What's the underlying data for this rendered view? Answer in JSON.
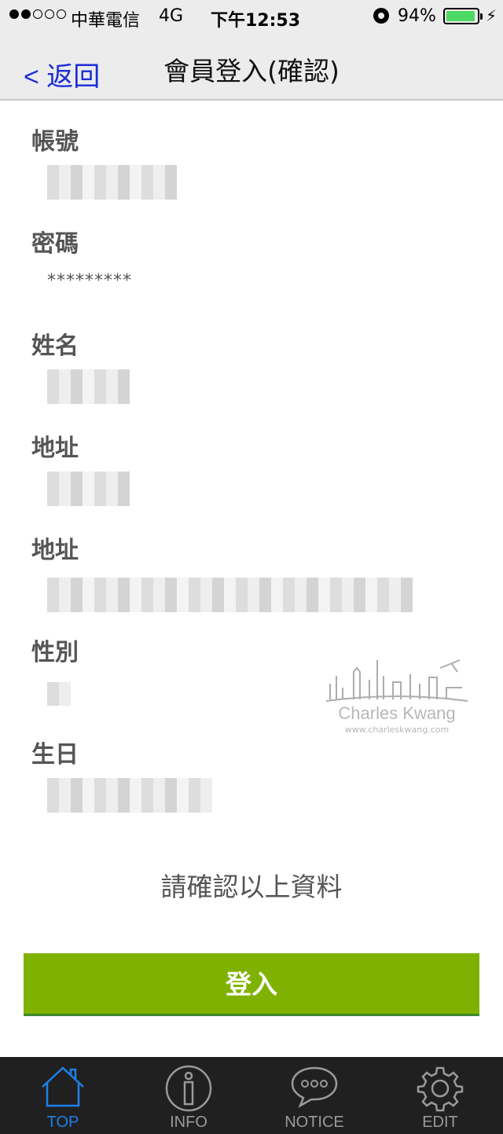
{
  "status_bar": {
    "carrier": "中華電信",
    "network": "4G",
    "time": "下午12:53",
    "battery_percent": "94%",
    "battery_level": 0.94,
    "signal_bars_filled": 2,
    "signal_bars_total": 5
  },
  "nav": {
    "back_label": "< 返回",
    "title": "會員登入(確認)"
  },
  "form": {
    "account_label": "帳號",
    "password_label": "密碼",
    "password_value": "*********",
    "name_label": "姓名",
    "address1_label": "地址",
    "address2_label": "地址",
    "gender_label": "性別",
    "birthday_label": "生日"
  },
  "confirm_text": "請確認以上資料",
  "login_button": "登入",
  "watermark": {
    "name": "Charles Kwang",
    "url": "www.charleskwang.com"
  },
  "tabs": [
    {
      "label": "TOP",
      "icon": "home-icon",
      "active": true
    },
    {
      "label": "INFO",
      "icon": "info-icon",
      "active": false
    },
    {
      "label": "NOTICE",
      "icon": "chat-bubble-icon",
      "active": false
    },
    {
      "label": "EDIT",
      "icon": "gear-icon",
      "active": false
    }
  ],
  "colors": {
    "accent_blue": "#1a2dd6",
    "button_green": "#7fb200",
    "active_tab": "#1e7fe8",
    "battery_green": "#4cd964"
  }
}
